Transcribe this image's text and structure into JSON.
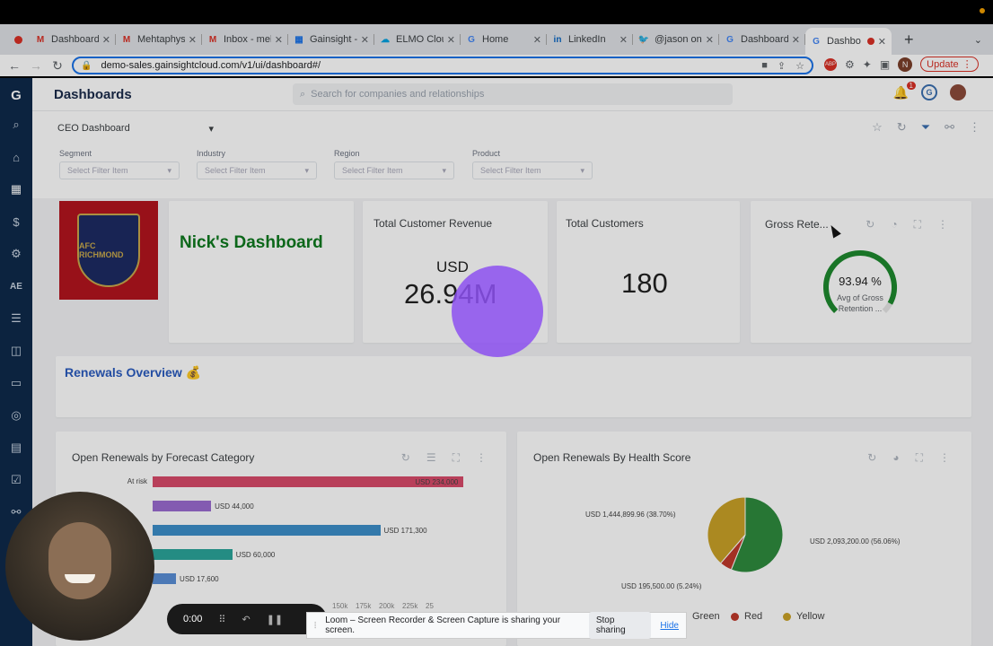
{
  "browser": {
    "tabs": [
      {
        "title": "Dashboard",
        "favicon": "gmail-icon"
      },
      {
        "title": "Mehtaphys",
        "favicon": "gmail-icon"
      },
      {
        "title": "Inbox - meh",
        "favicon": "gmail-icon"
      },
      {
        "title": "Gainsight -",
        "favicon": "google-sheets-icon"
      },
      {
        "title": "ELMO Clou",
        "favicon": "salesforce-icon"
      },
      {
        "title": "Home",
        "favicon": "google-icon"
      },
      {
        "title": "LinkedIn",
        "favicon": "linkedin-icon"
      },
      {
        "title": "@jason on",
        "favicon": "twitter-icon"
      },
      {
        "title": "Dashboard",
        "favicon": "google-icon"
      },
      {
        "title": "Dashbo",
        "favicon": "google-icon",
        "active": true
      }
    ],
    "url": "demo-sales.gainsightcloud.com/v1/ui/dashboard#/",
    "update_label": "Update",
    "profile_initial": "N"
  },
  "app": {
    "page_title": "Dashboards",
    "search_placeholder": "Search for companies and relationships",
    "notification_count": "1",
    "dashboard_select": "CEO Dashboard",
    "filters": [
      {
        "label": "Segment",
        "placeholder": "Select Filter Item"
      },
      {
        "label": "Industry",
        "placeholder": "Select Filter Item"
      },
      {
        "label": "Region",
        "placeholder": "Select Filter Item"
      },
      {
        "label": "Product",
        "placeholder": "Select Filter Item"
      }
    ],
    "nick_title": "Nick's Dashboard",
    "crest_text": "AFC RICHMOND",
    "revenue": {
      "title": "Total Customer Revenue",
      "currency": "USD",
      "value": "26.94M"
    },
    "customers": {
      "title": "Total Customers",
      "value": "180"
    },
    "retention": {
      "title": "Gross Rete...",
      "percent": "93.94 %",
      "fraction": 0.9394,
      "caption": "Avg of Gross Retention ..."
    },
    "renewals_title": "Renewals Overview 💰",
    "forecast_chart": {
      "title": "Open Renewals by Forecast Category"
    },
    "health_chart": {
      "title": "Open Renewals By Health Score"
    }
  },
  "chart_data": [
    {
      "type": "bar",
      "title": "Open Renewals by Forecast Category",
      "categories": [
        "At risk",
        "",
        "",
        "",
        ""
      ],
      "values": [
        234000,
        44000,
        171300,
        60000,
        17600
      ],
      "value_labels": [
        "USD 234,000",
        "USD 44,000",
        "USD 171,300",
        "USD 60,000",
        "USD 17,600"
      ],
      "colors": [
        "#d94b6a",
        "#9b6bd1",
        "#3d8fc9",
        "#2ba59a",
        "#5a8fd6"
      ],
      "x_ticks": [
        "150k",
        "175k",
        "200k",
        "225k",
        "25"
      ],
      "xlim": [
        0,
        250000
      ]
    },
    {
      "type": "pie",
      "title": "Open Renewals By Health Score",
      "slices": [
        {
          "name": "Green",
          "value": 2093200,
          "label": "USD 2,093,200.00 (56.06%)",
          "color": "#2e8b3e"
        },
        {
          "name": "Red",
          "value": 195500,
          "label": "USD 195,500.00 (5.24%)",
          "color": "#c0392b"
        },
        {
          "name": "Yellow",
          "value": 1444899.96,
          "label": "USD 1,444,899.96 (38.70%)",
          "color": "#c9a227"
        }
      ],
      "legend": [
        "Green",
        "Red",
        "Yellow"
      ]
    }
  ],
  "loom": {
    "timer": "0:00",
    "share_message": "Loom – Screen Recorder & Screen Capture is sharing your screen.",
    "stop_label": "Stop sharing",
    "hide_label": "Hide"
  }
}
